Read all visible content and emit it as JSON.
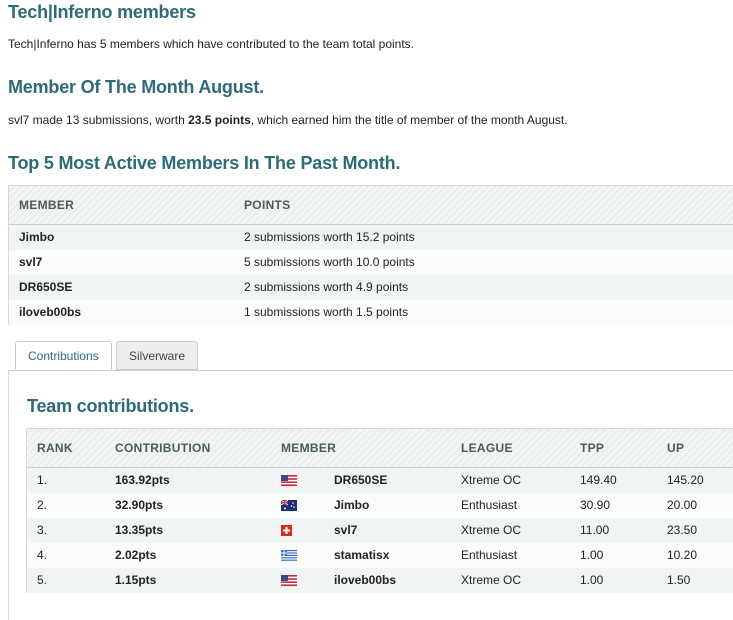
{
  "team": {
    "title": "Tech|Inferno members",
    "description": "Tech|Inferno has 5 members which have contributed to the team total points."
  },
  "motm": {
    "title": "Member Of The Month August.",
    "text_before": "svl7 made 13 submissions, worth ",
    "points": "23.5 points",
    "text_after": ", which earned him the title of member of the month August."
  },
  "top5": {
    "title": "Top 5 Most Active Members In The Past Month.",
    "columns": [
      "MEMBER",
      "POINTS"
    ],
    "rows": [
      {
        "member": "Jimbo",
        "points": "2 submissions worth 15.2 points"
      },
      {
        "member": "svl7",
        "points": "5 submissions worth 10.0 points"
      },
      {
        "member": "DR650SE",
        "points": "2 submissions worth 4.9 points"
      },
      {
        "member": "iloveb00bs",
        "points": "1 submissions worth 1.5 points"
      }
    ]
  },
  "tabs": [
    {
      "label": "Contributions",
      "active": true
    },
    {
      "label": "Silverware",
      "active": false
    }
  ],
  "contributions": {
    "title": "Team contributions.",
    "columns": [
      "RANK",
      "CONTRIBUTION",
      "MEMBER",
      "LEAGUE",
      "TPP",
      "UP"
    ],
    "rows": [
      {
        "rank": "1.",
        "contribution": "163.92pts",
        "flag": "us-flag-icon",
        "member": "DR650SE",
        "league": "Xtreme OC",
        "tpp": "149.40",
        "up": "145.20"
      },
      {
        "rank": "2.",
        "contribution": "32.90pts",
        "flag": "au-flag-icon",
        "member": "Jimbo",
        "league": "Enthusiast",
        "tpp": "30.90",
        "up": "20.00"
      },
      {
        "rank": "3.",
        "contribution": "13.35pts",
        "flag": "ch-flag-icon",
        "member": "svl7",
        "league": "Xtreme OC",
        "tpp": "11.00",
        "up": "23.50"
      },
      {
        "rank": "4.",
        "contribution": "2.02pts",
        "flag": "gr-flag-icon",
        "member": "stamatisx",
        "league": "Enthusiast",
        "tpp": "1.00",
        "up": "10.20"
      },
      {
        "rank": "5.",
        "contribution": "1.15pts",
        "flag": "us-flag-icon",
        "member": "iloveb00bs",
        "league": "Xtreme OC",
        "tpp": "1.00",
        "up": "1.50"
      }
    ]
  },
  "colors": {
    "heading": "#2d6a7a",
    "row_odd": "#f1f4f4",
    "row_even": "#fafbfb"
  }
}
